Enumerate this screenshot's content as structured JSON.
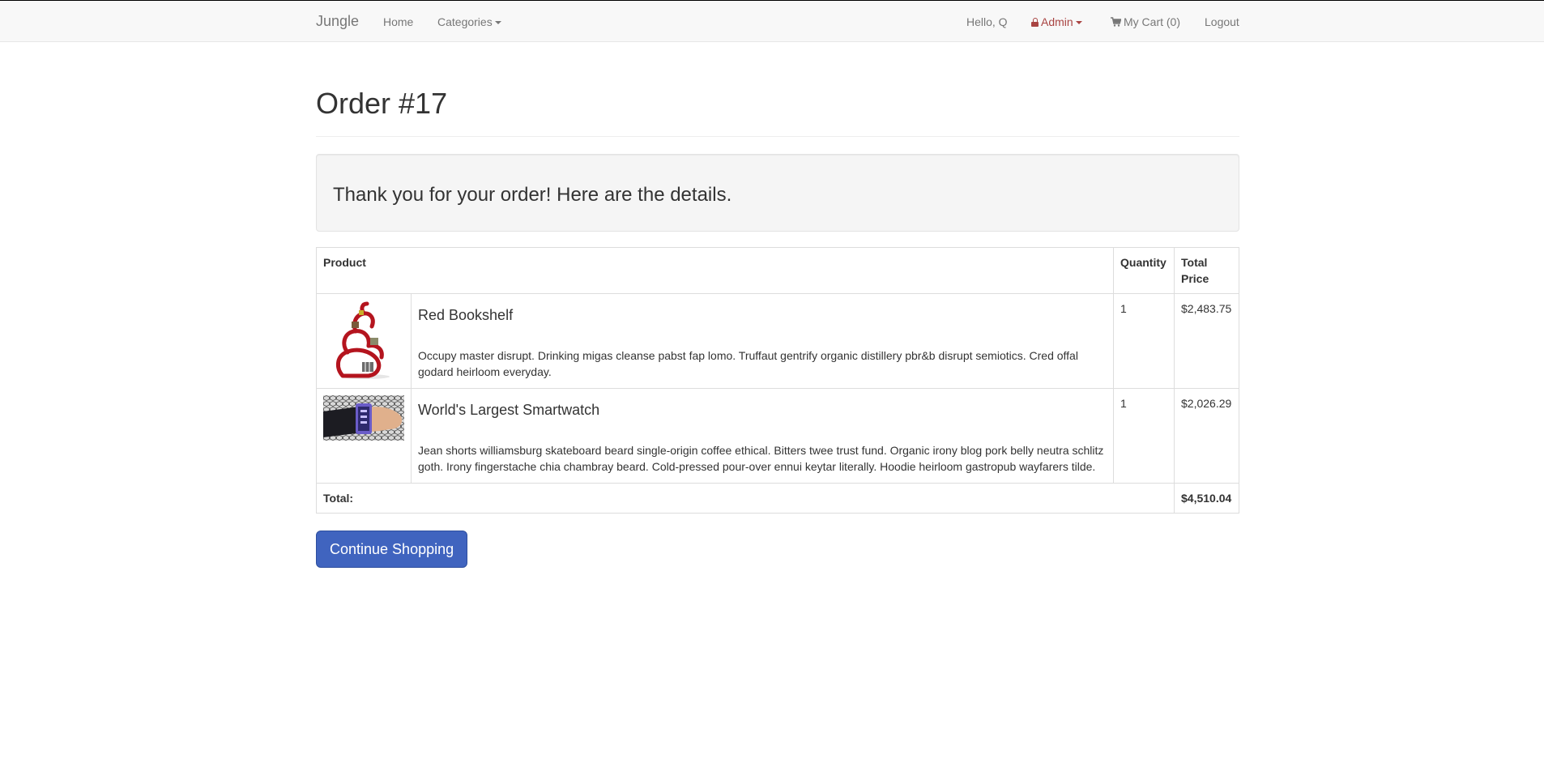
{
  "navbar": {
    "brand": "Jungle",
    "home": "Home",
    "categories": "Categories",
    "greeting": "Hello, Q",
    "admin": "Admin",
    "cart": "My Cart (0)",
    "logout": "Logout",
    "icons": {
      "admin": "lock-icon",
      "cart": "shopping-cart-icon",
      "dropdown": "caret-down-icon"
    }
  },
  "page": {
    "title": "Order #17",
    "message": "Thank you for your order! Here are the details."
  },
  "table": {
    "headers": {
      "product": "Product",
      "quantity": "Quantity",
      "total_price": "Total Price"
    },
    "items": [
      {
        "name": "Red Bookshelf",
        "description": "Occupy master disrupt. Drinking migas cleanse pabst fap lomo. Truffaut gentrify organic distillery pbr&b disrupt semiotics. Cred offal godard heirloom everyday.",
        "quantity": "1",
        "total_price": "$2,483.75",
        "image": "red-bookshelf-image"
      },
      {
        "name": "World's Largest Smartwatch",
        "description": "Jean shorts williamsburg skateboard beard single-origin coffee ethical. Bitters twee trust fund. Organic irony blog pork belly neutra schlitz goth. Irony fingerstache chia chambray beard. Cold-pressed pour-over ennui keytar literally. Hoodie heirloom gastropub wayfarers tilde.",
        "quantity": "1",
        "total_price": "$2,026.29",
        "image": "smartwatch-image"
      }
    ],
    "total_label": "Total:",
    "total_value": "$4,510.04"
  },
  "actions": {
    "continue_shopping": "Continue Shopping"
  },
  "colors": {
    "navbar_bg": "#f8f8f8",
    "nav_text": "#777777",
    "admin": "#a94442",
    "well_bg": "#f5f5f5",
    "primary_button": "#4064bf"
  }
}
